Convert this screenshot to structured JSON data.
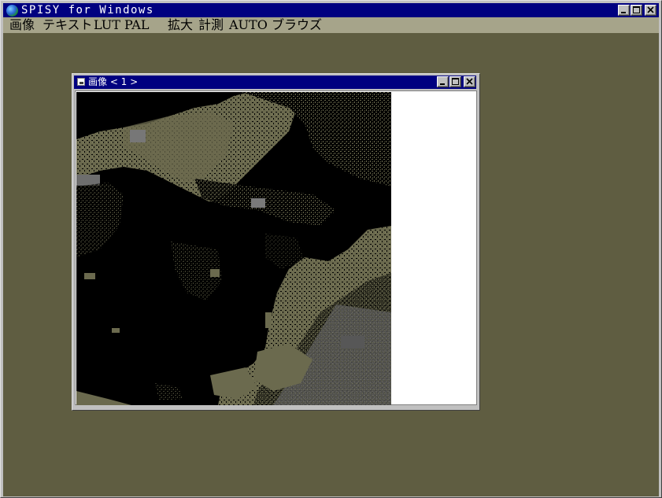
{
  "app": {
    "title": "SPISY for Windows",
    "icon": "globe-icon",
    "controls": [
      "minimize-icon",
      "maximize-icon",
      "close-icon"
    ]
  },
  "menubar": {
    "items": [
      {
        "label": "画像"
      },
      {
        "label": "テキスト"
      },
      {
        "label": "LUT"
      },
      {
        "label": "PAL"
      },
      {
        "label": "拡大"
      },
      {
        "label": "計測"
      },
      {
        "label": "AUTO"
      },
      {
        "label": "ブラウズ"
      }
    ]
  },
  "child_window": {
    "title": "画像 < 1 >",
    "icon": "document-icon",
    "controls": [
      "minimize-icon",
      "maximize-icon",
      "close-icon"
    ],
    "content": "satellite-image"
  },
  "colors": {
    "title_active": "#000080",
    "face": "#c0c0c0",
    "menubar": "#a6a48a",
    "workspace": "#5f5d41",
    "land": "#6b6a4e",
    "land_light": "#868463",
    "cloud_gray": "#6e6e6e",
    "background_black": "#000000"
  }
}
